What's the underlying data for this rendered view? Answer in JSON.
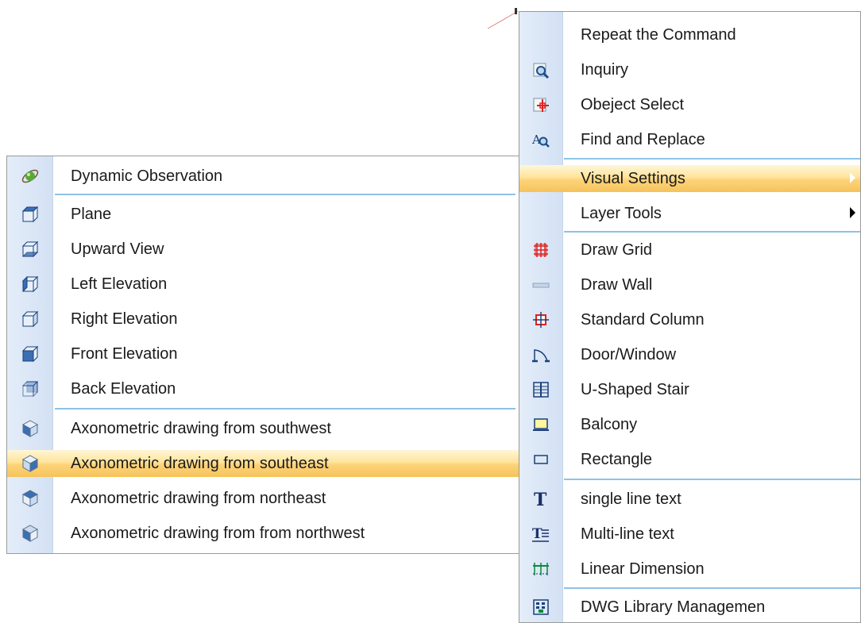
{
  "context_menu": {
    "items": [
      {
        "label": "Repeat the Command",
        "icon": "none"
      },
      {
        "label": "Inquiry",
        "icon": "magnifier-icon"
      },
      {
        "label": "Obeject Select",
        "icon": "object-select-icon"
      },
      {
        "label": "Find and Replace",
        "icon": "find-replace-icon"
      },
      {
        "label": "Visual Settings",
        "icon": "none",
        "submenu": true,
        "highlighted": true
      },
      {
        "label": "Layer Tools",
        "icon": "none",
        "submenu": true
      },
      {
        "label": "Draw Grid",
        "icon": "grid-icon"
      },
      {
        "label": "Draw Wall",
        "icon": "wall-icon"
      },
      {
        "label": "Standard Column",
        "icon": "column-icon"
      },
      {
        "label": "Door/Window",
        "icon": "door-window-icon"
      },
      {
        "label": "U-Shaped Stair",
        "icon": "stair-icon"
      },
      {
        "label": "Balcony",
        "icon": "balcony-icon"
      },
      {
        "label": "Rectangle",
        "icon": "rectangle-icon"
      },
      {
        "label": "single line text",
        "icon": "text-icon"
      },
      {
        "label": "Multi-line text",
        "icon": "multiline-text-icon"
      },
      {
        "label": "Linear Dimension",
        "icon": "dimension-icon"
      },
      {
        "label": "DWG Library Managemen",
        "icon": "library-icon"
      }
    ]
  },
  "visual_settings_submenu": {
    "items": [
      {
        "label": "Dynamic Observation",
        "icon": "orbit-icon"
      },
      {
        "label": "Plane",
        "icon": "cube-top-icon"
      },
      {
        "label": "Upward View",
        "icon": "cube-bottom-icon"
      },
      {
        "label": "Left Elevation",
        "icon": "cube-left-icon"
      },
      {
        "label": "Right Elevation",
        "icon": "cube-right-icon"
      },
      {
        "label": "Front Elevation",
        "icon": "cube-front-icon"
      },
      {
        "label": "Back Elevation",
        "icon": "cube-back-icon"
      },
      {
        "label": "Axonometric drawing from southwest",
        "icon": "iso-sw-icon"
      },
      {
        "label": "Axonometric drawing from southeast",
        "icon": "iso-se-icon",
        "highlighted": true
      },
      {
        "label": "Axonometric drawing from northeast",
        "icon": "iso-ne-icon"
      },
      {
        "label": "Axonometric drawing from from northwest",
        "icon": "iso-nw-icon"
      }
    ]
  },
  "colors": {
    "highlight": "#fdd37a",
    "separator": "#8ec3e6",
    "gutter": "#d3e1f4",
    "icon_blue": "#3a6fb5",
    "icon_red": "#e02020"
  }
}
